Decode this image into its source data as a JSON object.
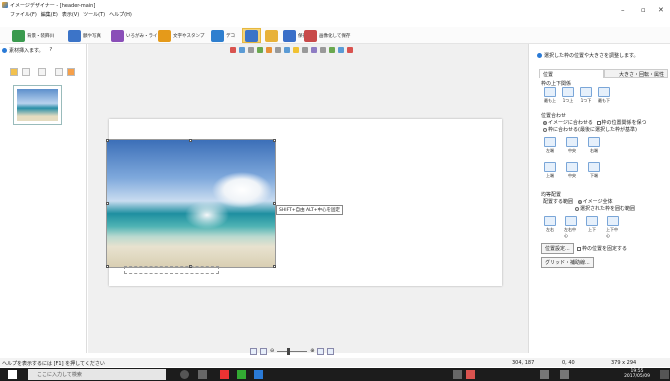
{
  "window": {
    "title": "イメージデザイナー - [header-main]"
  },
  "menu": [
    "ファイル(F)",
    "編集(E)",
    "表示(V)",
    "ツール(T)",
    "ヘルプ(H)"
  ],
  "toolbar": [
    {
      "label": "背景・装飾(I)",
      "icon": "landscape-icon",
      "color": "#3a9a4e"
    },
    {
      "label": "額や写真",
      "icon": "photo-frame-icon",
      "color": "#3c74c8"
    },
    {
      "label": "いろがみ・ライン",
      "icon": "ribbon-icon",
      "color": "#8a4fb8"
    },
    {
      "label": "文字やスタンプ",
      "icon": "text-a-icon",
      "color": "#e59a1a"
    },
    {
      "label": "デコ",
      "icon": "deco-icon",
      "color": "#2f7fcf"
    },
    {
      "label": "",
      "icon": "image-insert-icon",
      "color": "#3c74c8"
    },
    {
      "label": "",
      "icon": "folder-icon",
      "color": "#e8b23a"
    },
    {
      "label": "保存",
      "icon": "save-icon",
      "color": "#3a6fc8"
    },
    {
      "label": "画像化して保存",
      "icon": "export-image-icon",
      "color": "#c84a4a"
    }
  ],
  "left_panel": {
    "header": "素材挿入ます。",
    "help": "?"
  },
  "canvas": {
    "tooltip": "SHIFT+自由 ALT+中心を固定"
  },
  "right_panel": {
    "header": "選択した枠の位置や大きさを調整します。",
    "tabs": [
      "位置",
      "大きさ・回転・属性"
    ],
    "order": {
      "title": "枠の上下関係",
      "buttons": [
        "最も上",
        "1つ上",
        "1つ下",
        "最も下"
      ]
    },
    "align": {
      "title": "位置合わせ",
      "radio1": "イメージに合わせる",
      "check1": "枠の位置関係を保つ",
      "radio2": "枠に合わせる(最後に選択した枠が基準)",
      "row1": [
        "左端",
        "中央",
        "右端"
      ],
      "row2": [
        "上端",
        "中央",
        "下端"
      ]
    },
    "distribute": {
      "title": "均等配置",
      "range_label": "配置する範囲",
      "radio1": "イメージ全体",
      "radio2": "選択された枠を囲む範囲",
      "buttons": [
        "左右",
        "左右中心",
        "上下",
        "上下中心"
      ]
    },
    "position_btn": "位置設定...",
    "fix_check": "枠の位置を固定する",
    "grid_btn": "グリッド・補助線..."
  },
  "status": {
    "help": "ヘルプを表示するには [F1] を押してください",
    "pos": "304, 187",
    "offset": "0, 40",
    "size": "379 x 294"
  },
  "taskbar": {
    "search": "ここに入力して検索",
    "time": "19:55",
    "date": "2017/05/09"
  }
}
